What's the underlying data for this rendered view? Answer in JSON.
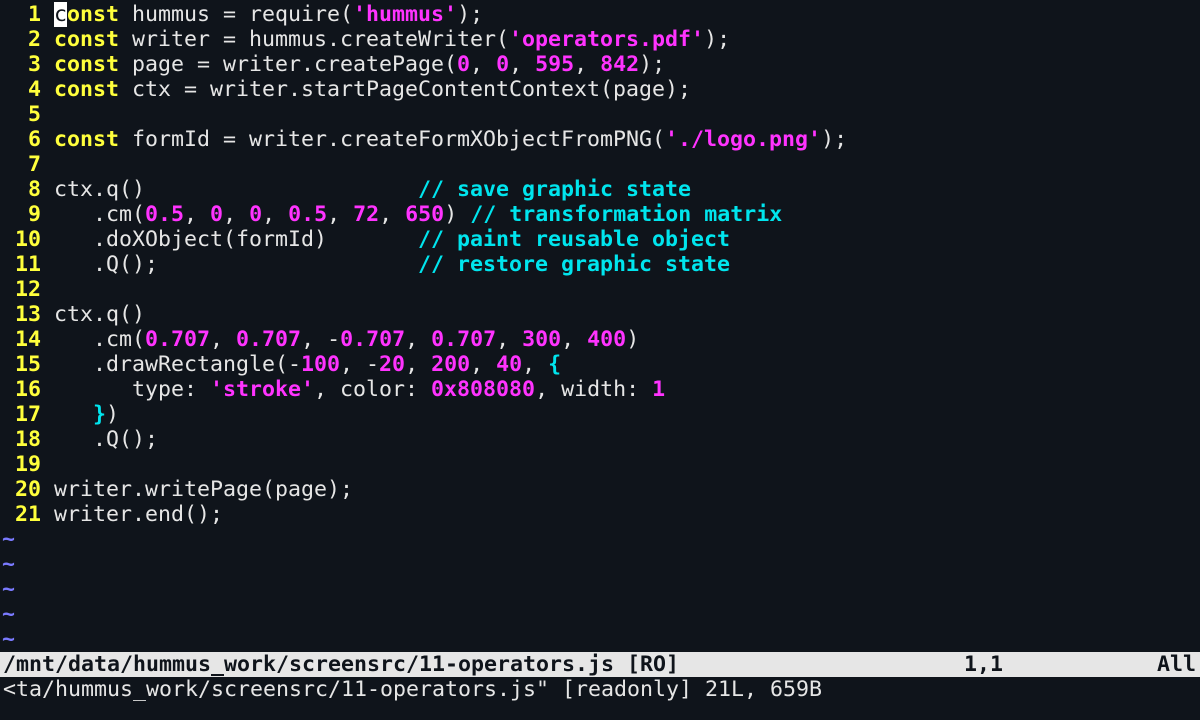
{
  "editor": {
    "lines": [
      {
        "n": "1",
        "tokens": [
          [
            "cursor",
            "c"
          ],
          [
            "kw",
            "onst"
          ],
          [
            "plain",
            " hummus = require("
          ],
          [
            "str",
            "'hummus'"
          ],
          [
            "plain",
            ");"
          ]
        ]
      },
      {
        "n": "2",
        "tokens": [
          [
            "kw",
            "const"
          ],
          [
            "plain",
            " writer = hummus.createWriter("
          ],
          [
            "str",
            "'operators.pdf'"
          ],
          [
            "plain",
            ");"
          ]
        ]
      },
      {
        "n": "3",
        "tokens": [
          [
            "kw",
            "const"
          ],
          [
            "plain",
            " page = writer.createPage("
          ],
          [
            "num",
            "0"
          ],
          [
            "plain",
            ", "
          ],
          [
            "num",
            "0"
          ],
          [
            "plain",
            ", "
          ],
          [
            "num",
            "595"
          ],
          [
            "plain",
            ", "
          ],
          [
            "num",
            "842"
          ],
          [
            "plain",
            ");"
          ]
        ]
      },
      {
        "n": "4",
        "tokens": [
          [
            "kw",
            "const"
          ],
          [
            "plain",
            " ctx = writer.startPageContentContext(page);"
          ]
        ]
      },
      {
        "n": "5",
        "tokens": []
      },
      {
        "n": "6",
        "tokens": [
          [
            "kw",
            "const"
          ],
          [
            "plain",
            " formId = writer.createFormXObjectFromPNG("
          ],
          [
            "str",
            "'./logo.png'"
          ],
          [
            "plain",
            ");"
          ]
        ]
      },
      {
        "n": "7",
        "tokens": []
      },
      {
        "n": "8",
        "tokens": [
          [
            "plain",
            "ctx.q()                     "
          ],
          [
            "cmt",
            "// save graphic state"
          ]
        ]
      },
      {
        "n": "9",
        "tokens": [
          [
            "plain",
            "   .cm("
          ],
          [
            "num",
            "0.5"
          ],
          [
            "plain",
            ", "
          ],
          [
            "num",
            "0"
          ],
          [
            "plain",
            ", "
          ],
          [
            "num",
            "0"
          ],
          [
            "plain",
            ", "
          ],
          [
            "num",
            "0.5"
          ],
          [
            "plain",
            ", "
          ],
          [
            "num",
            "72"
          ],
          [
            "plain",
            ", "
          ],
          [
            "num",
            "650"
          ],
          [
            "plain",
            ") "
          ],
          [
            "cmt",
            "// transformation matrix"
          ]
        ]
      },
      {
        "n": "10",
        "tokens": [
          [
            "plain",
            "   .doXObject(formId)       "
          ],
          [
            "cmt",
            "// paint reusable object"
          ]
        ]
      },
      {
        "n": "11",
        "tokens": [
          [
            "plain",
            "   .Q();                    "
          ],
          [
            "cmt",
            "// restore graphic state"
          ]
        ]
      },
      {
        "n": "12",
        "tokens": []
      },
      {
        "n": "13",
        "tokens": [
          [
            "plain",
            "ctx.q()"
          ]
        ]
      },
      {
        "n": "14",
        "tokens": [
          [
            "plain",
            "   .cm("
          ],
          [
            "num",
            "0.707"
          ],
          [
            "plain",
            ", "
          ],
          [
            "num",
            "0.707"
          ],
          [
            "plain",
            ", -"
          ],
          [
            "num",
            "0.707"
          ],
          [
            "plain",
            ", "
          ],
          [
            "num",
            "0.707"
          ],
          [
            "plain",
            ", "
          ],
          [
            "num",
            "300"
          ],
          [
            "plain",
            ", "
          ],
          [
            "num",
            "400"
          ],
          [
            "plain",
            ")"
          ]
        ]
      },
      {
        "n": "15",
        "tokens": [
          [
            "plain",
            "   .drawRectangle(-"
          ],
          [
            "num",
            "100"
          ],
          [
            "plain",
            ", -"
          ],
          [
            "num",
            "20"
          ],
          [
            "plain",
            ", "
          ],
          [
            "num",
            "200"
          ],
          [
            "plain",
            ", "
          ],
          [
            "num",
            "40"
          ],
          [
            "plain",
            ", "
          ],
          [
            "brace",
            "{"
          ]
        ]
      },
      {
        "n": "16",
        "tokens": [
          [
            "plain",
            "      type: "
          ],
          [
            "str",
            "'stroke'"
          ],
          [
            "plain",
            ", color: "
          ],
          [
            "num",
            "0x808080"
          ],
          [
            "plain",
            ", width: "
          ],
          [
            "num",
            "1"
          ]
        ]
      },
      {
        "n": "17",
        "tokens": [
          [
            "plain",
            "   "
          ],
          [
            "brace",
            "}"
          ],
          [
            "plain",
            ")"
          ]
        ]
      },
      {
        "n": "18",
        "tokens": [
          [
            "plain",
            "   .Q();"
          ]
        ]
      },
      {
        "n": "19",
        "tokens": []
      },
      {
        "n": "20",
        "tokens": [
          [
            "plain",
            "writer.writePage(page);"
          ]
        ]
      },
      {
        "n": "21",
        "tokens": [
          [
            "plain",
            "writer.end();"
          ]
        ]
      }
    ],
    "empty_marker": "~",
    "empty_rows": 5
  },
  "status": {
    "file": "/mnt/data/hummus_work/screensrc/11-operators.js [RO]",
    "position": "1,1",
    "percent": "All"
  },
  "message": "<ta/hummus_work/screensrc/11-operators.js\" [readonly] 21L, 659B",
  "colors": {
    "background": "#0f141b",
    "keyword": "#ffff3c",
    "string_number": "#ff33ff",
    "comment": "#00e5ee",
    "tilde": "#7a7aff",
    "statusline_bg": "#e6e6e6"
  }
}
